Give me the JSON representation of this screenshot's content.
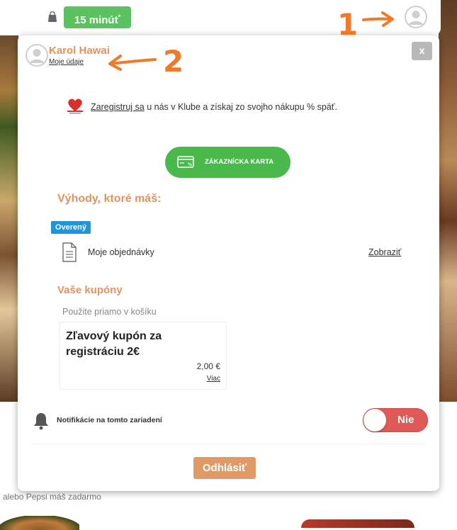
{
  "header": {
    "time_badge": "15 minút",
    "time_badge_sup": "*"
  },
  "panel": {
    "user_name": "Karol Hawai",
    "my_data_link": "Moje údaje",
    "close_label": "x",
    "club": {
      "link_text": "Zaregistruj sa",
      "text": " u nás v Klube a získaj zo svojho nákupu % späť."
    },
    "customer_card_label": "ZÁKAZNÍCKA KARTA",
    "benefits_title": "Výhody, ktoré máš:",
    "verified_badge": "Overený",
    "orders": {
      "label": "Moje objednávky",
      "action": "Zobraziť"
    },
    "coupons": {
      "title": "Vaše kupóny",
      "hint": "Použite priamo v košíku",
      "items": [
        {
          "title": "Zľavový kupón za registráciu 2€",
          "price": "2,00 €",
          "more": "Viac"
        }
      ]
    },
    "notifications": {
      "label": "Notifikácie na tomto zariadení",
      "toggle_state": "Nie"
    },
    "logout_label": "Odhlásiť"
  },
  "background": {
    "behind_text": "alebo Pepsi máš zadarmo"
  },
  "annotations": {
    "marker_1": "1",
    "marker_2": "2"
  },
  "colors": {
    "accent_orange": "#e0935d",
    "green": "#49b94c",
    "badge_blue": "#1d97d9",
    "toggle_red": "#e05a57",
    "annotation_orange": "#f07a2a"
  }
}
